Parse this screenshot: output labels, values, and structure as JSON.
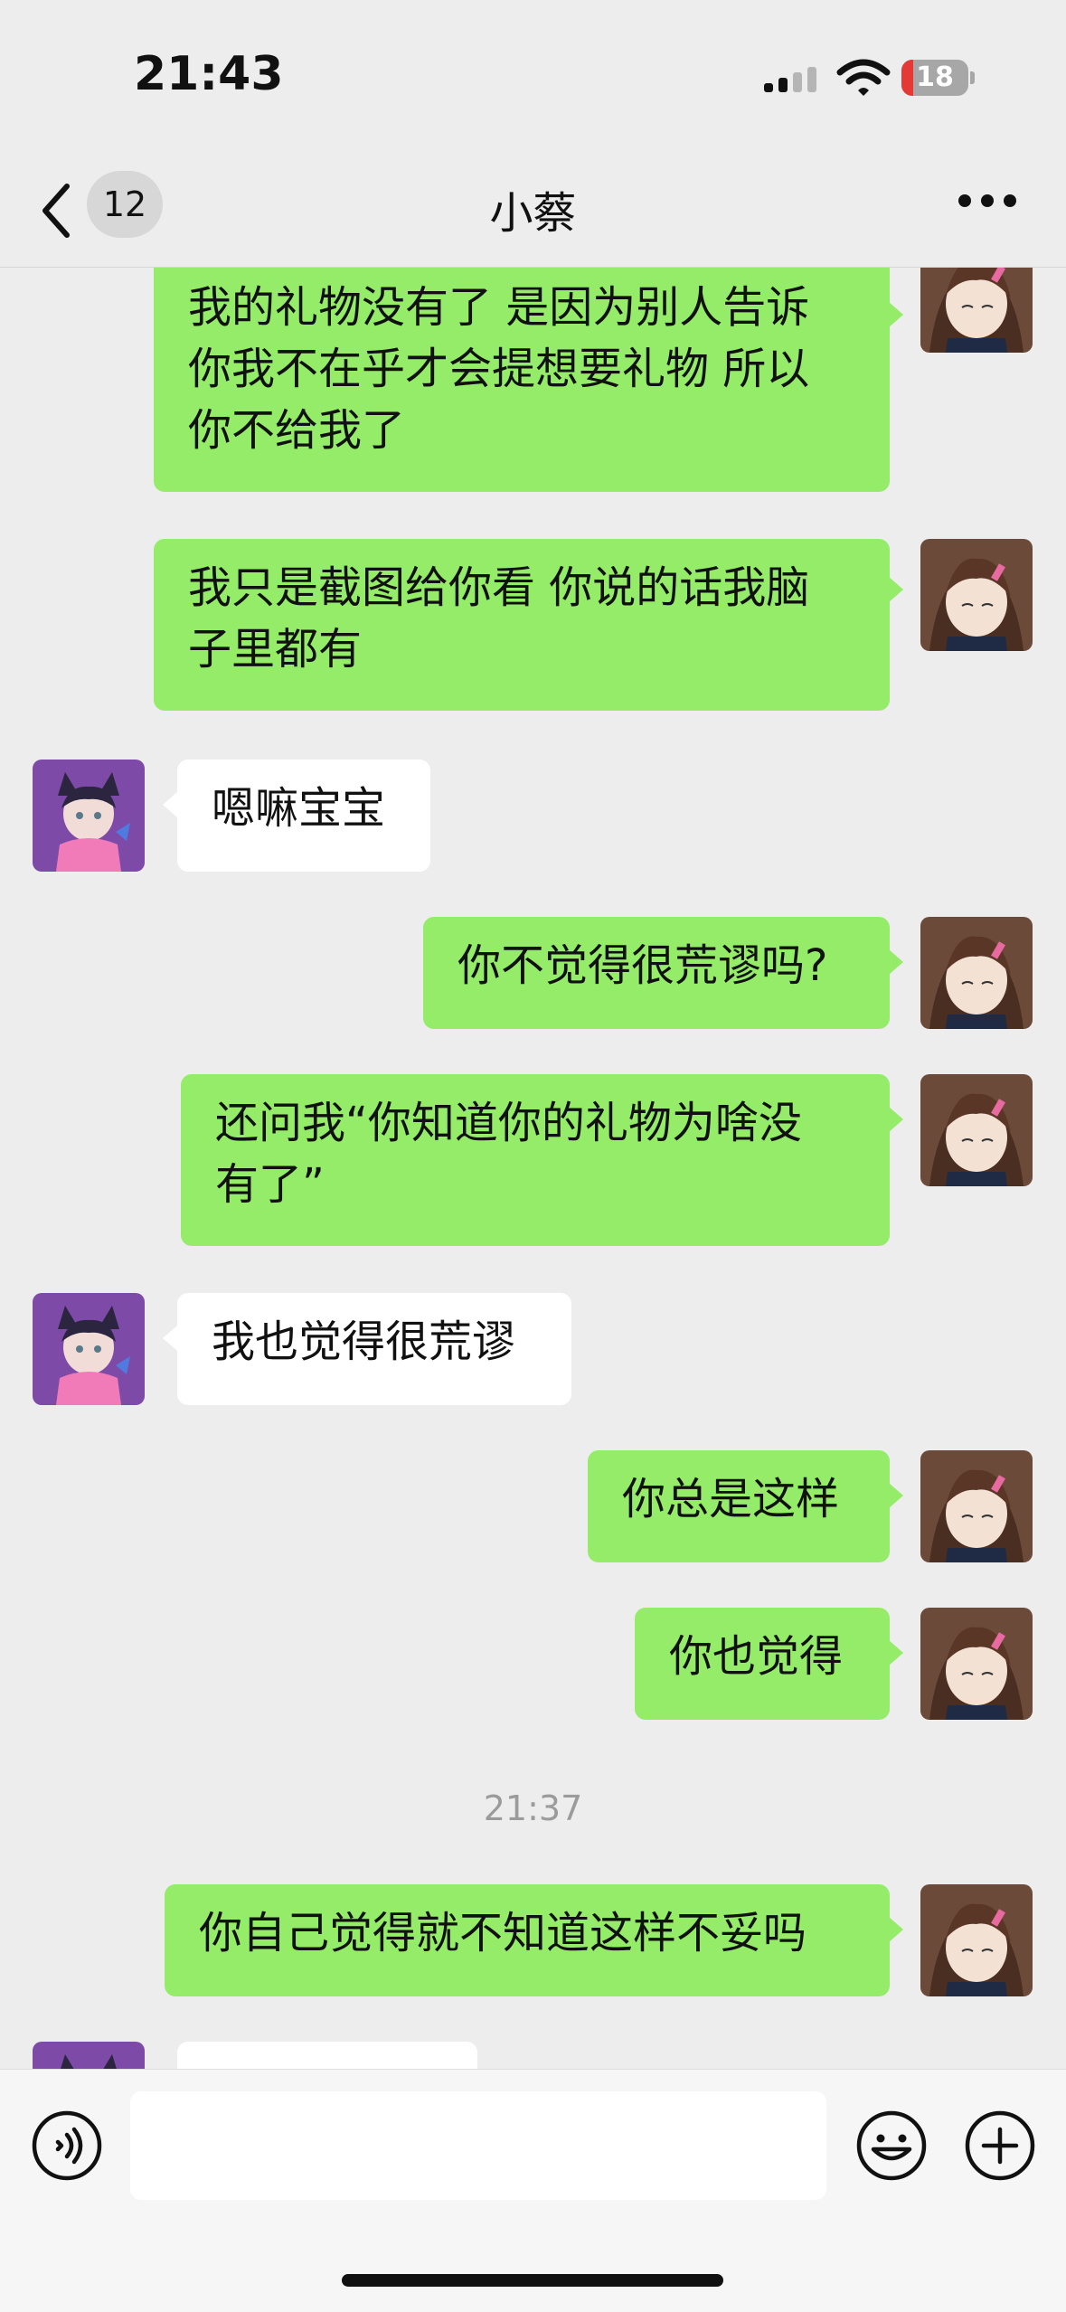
{
  "status_bar": {
    "time": "21:43",
    "battery": "18",
    "battery_level": 0.18
  },
  "header": {
    "back_count": "12",
    "title": "小蔡"
  },
  "messages": [
    {
      "from": "me",
      "text": "我的礼物没有了 是因为别人告诉\n你我不在乎才会提想要礼物 所以\n你不给我了"
    },
    {
      "from": "me",
      "text": "我只是截图给你看 你说的话我脑\n子里都有"
    },
    {
      "from": "other",
      "text": "嗯嘛宝宝"
    },
    {
      "from": "me",
      "text": "你不觉得很荒谬吗?"
    },
    {
      "from": "me",
      "text": "还问我“你知道你的礼物为啥没\n有了”"
    },
    {
      "from": "other",
      "text": "我也觉得很荒谬"
    },
    {
      "from": "me",
      "text": "你总是这样"
    },
    {
      "from": "me",
      "text": "你也觉得"
    },
    {
      "from": "me",
      "text": "你自己觉得就不知道这样不妥吗"
    },
    {
      "from": "other",
      "text": ""
    }
  ],
  "timestamp": "21:37",
  "icons": {
    "back": "chevron-left-icon",
    "more": "more-dots-icon",
    "voice": "voice-icon",
    "emoji": "emoji-icon",
    "plus": "plus-icon"
  },
  "colors": {
    "my_bubble": "#95ec69",
    "their_bubble": "#ffffff",
    "background": "#ededed"
  }
}
